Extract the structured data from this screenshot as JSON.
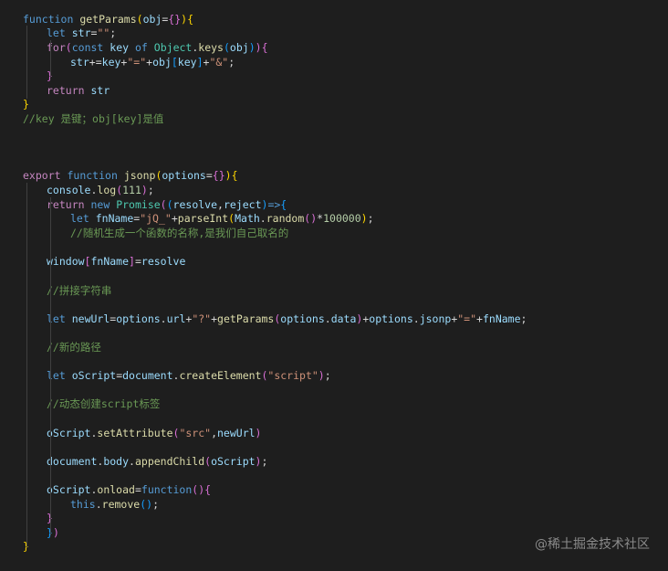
{
  "colors": {
    "background": "#1e1e1e",
    "keyword_control": "#c586c0",
    "keyword": "#569cd6",
    "function_name": "#dcdcaa",
    "variable": "#9cdcfe",
    "string": "#ce9178",
    "number": "#b5cea8",
    "comment": "#6a9955",
    "class_name": "#4ec9b0",
    "bracket_1": "#ffd700",
    "bracket_2": "#da70d6",
    "bracket_3": "#179fff",
    "plain": "#d4d4d4"
  },
  "code_lines": [
    {
      "tokens": [
        {
          "t": "function",
          "c": "keyword"
        },
        {
          "t": " ",
          "c": "plain"
        },
        {
          "t": "getParams",
          "c": "function_name"
        },
        {
          "t": "(",
          "c": "bracket_1"
        },
        {
          "t": "obj",
          "c": "variable"
        },
        {
          "t": "=",
          "c": "plain"
        },
        {
          "t": "{}",
          "c": "bracket_2"
        },
        {
          "t": ")",
          "c": "bracket_1"
        },
        {
          "t": "{",
          "c": "bracket_1"
        }
      ]
    },
    {
      "tokens": [
        {
          "t": "let",
          "c": "keyword"
        },
        {
          "t": " ",
          "c": "plain"
        },
        {
          "t": "str",
          "c": "variable"
        },
        {
          "t": "=",
          "c": "plain"
        },
        {
          "t": "\"\"",
          "c": "string"
        },
        {
          "t": ";",
          "c": "plain"
        }
      ]
    },
    {
      "tokens": [
        {
          "t": "for",
          "c": "keyword_control"
        },
        {
          "t": "(",
          "c": "bracket_2"
        },
        {
          "t": "const",
          "c": "keyword"
        },
        {
          "t": " ",
          "c": "plain"
        },
        {
          "t": "key",
          "c": "variable"
        },
        {
          "t": " ",
          "c": "plain"
        },
        {
          "t": "of",
          "c": "keyword"
        },
        {
          "t": " ",
          "c": "plain"
        },
        {
          "t": "Object",
          "c": "class_name"
        },
        {
          "t": ".",
          "c": "plain"
        },
        {
          "t": "keys",
          "c": "function_name"
        },
        {
          "t": "(",
          "c": "bracket_3"
        },
        {
          "t": "obj",
          "c": "variable"
        },
        {
          "t": ")",
          "c": "bracket_3"
        },
        {
          "t": ")",
          "c": "bracket_2"
        },
        {
          "t": "{",
          "c": "bracket_2"
        }
      ]
    },
    {
      "tokens": [
        {
          "t": "str",
          "c": "variable"
        },
        {
          "t": "+=",
          "c": "plain"
        },
        {
          "t": "key",
          "c": "variable"
        },
        {
          "t": "+",
          "c": "plain"
        },
        {
          "t": "\"=\"",
          "c": "string"
        },
        {
          "t": "+",
          "c": "plain"
        },
        {
          "t": "obj",
          "c": "variable"
        },
        {
          "t": "[",
          "c": "bracket_3"
        },
        {
          "t": "key",
          "c": "variable"
        },
        {
          "t": "]",
          "c": "bracket_3"
        },
        {
          "t": "+",
          "c": "plain"
        },
        {
          "t": "\"&\"",
          "c": "string"
        },
        {
          "t": ";",
          "c": "plain"
        }
      ]
    },
    {
      "tokens": [
        {
          "t": "}",
          "c": "bracket_2"
        }
      ]
    },
    {
      "tokens": [
        {
          "t": "return",
          "c": "keyword_control"
        },
        {
          "t": " ",
          "c": "plain"
        },
        {
          "t": "str",
          "c": "variable"
        }
      ]
    },
    {
      "tokens": [
        {
          "t": "}",
          "c": "bracket_1"
        }
      ]
    },
    {
      "tokens": [
        {
          "t": "//key 是键；obj[key]是值",
          "c": "comment"
        }
      ]
    },
    {
      "tokens": [
        {
          "t": "export",
          "c": "keyword_control"
        },
        {
          "t": " ",
          "c": "plain"
        },
        {
          "t": "function",
          "c": "keyword"
        },
        {
          "t": " ",
          "c": "plain"
        },
        {
          "t": "jsonp",
          "c": "function_name"
        },
        {
          "t": "(",
          "c": "bracket_1"
        },
        {
          "t": "options",
          "c": "variable"
        },
        {
          "t": "=",
          "c": "plain"
        },
        {
          "t": "{}",
          "c": "bracket_2"
        },
        {
          "t": ")",
          "c": "bracket_1"
        },
        {
          "t": "{",
          "c": "bracket_1"
        }
      ]
    },
    {
      "tokens": [
        {
          "t": "console",
          "c": "variable"
        },
        {
          "t": ".",
          "c": "plain"
        },
        {
          "t": "log",
          "c": "function_name"
        },
        {
          "t": "(",
          "c": "bracket_2"
        },
        {
          "t": "111",
          "c": "number"
        },
        {
          "t": ")",
          "c": "bracket_2"
        },
        {
          "t": ";",
          "c": "plain"
        }
      ]
    },
    {
      "tokens": [
        {
          "t": "return",
          "c": "keyword_control"
        },
        {
          "t": " ",
          "c": "plain"
        },
        {
          "t": "new",
          "c": "keyword"
        },
        {
          "t": " ",
          "c": "plain"
        },
        {
          "t": "Promise",
          "c": "class_name"
        },
        {
          "t": "(",
          "c": "bracket_2"
        },
        {
          "t": "(",
          "c": "bracket_3"
        },
        {
          "t": "resolve",
          "c": "variable"
        },
        {
          "t": ",",
          "c": "plain"
        },
        {
          "t": "reject",
          "c": "variable"
        },
        {
          "t": ")",
          "c": "bracket_3"
        },
        {
          "t": "=>",
          "c": "keyword"
        },
        {
          "t": "{",
          "c": "bracket_3"
        }
      ]
    },
    {
      "tokens": [
        {
          "t": "let",
          "c": "keyword"
        },
        {
          "t": " ",
          "c": "plain"
        },
        {
          "t": "fnName",
          "c": "variable"
        },
        {
          "t": "=",
          "c": "plain"
        },
        {
          "t": "\"jQ_\"",
          "c": "string"
        },
        {
          "t": "+",
          "c": "plain"
        },
        {
          "t": "parseInt",
          "c": "function_name"
        },
        {
          "t": "(",
          "c": "bracket_1"
        },
        {
          "t": "Math",
          "c": "variable"
        },
        {
          "t": ".",
          "c": "plain"
        },
        {
          "t": "random",
          "c": "function_name"
        },
        {
          "t": "(",
          "c": "bracket_2"
        },
        {
          "t": ")",
          "c": "bracket_2"
        },
        {
          "t": "*",
          "c": "plain"
        },
        {
          "t": "100000",
          "c": "number"
        },
        {
          "t": ")",
          "c": "bracket_1"
        },
        {
          "t": ";",
          "c": "plain"
        }
      ]
    },
    {
      "tokens": [
        {
          "t": "//随机生成一个函数的名称,是我们自己取名的",
          "c": "comment"
        }
      ]
    },
    {
      "tokens": [
        {
          "t": "window",
          "c": "variable"
        },
        {
          "t": "[",
          "c": "bracket_2"
        },
        {
          "t": "fnName",
          "c": "variable"
        },
        {
          "t": "]",
          "c": "bracket_2"
        },
        {
          "t": "=",
          "c": "plain"
        },
        {
          "t": "resolve",
          "c": "variable"
        }
      ]
    },
    {
      "tokens": [
        {
          "t": "//拼接字符串",
          "c": "comment"
        }
      ]
    },
    {
      "tokens": [
        {
          "t": "let",
          "c": "keyword"
        },
        {
          "t": " ",
          "c": "plain"
        },
        {
          "t": "newUrl",
          "c": "variable"
        },
        {
          "t": "=",
          "c": "plain"
        },
        {
          "t": "options",
          "c": "variable"
        },
        {
          "t": ".",
          "c": "plain"
        },
        {
          "t": "url",
          "c": "variable"
        },
        {
          "t": "+",
          "c": "plain"
        },
        {
          "t": "\"?\"",
          "c": "string"
        },
        {
          "t": "+",
          "c": "plain"
        },
        {
          "t": "getParams",
          "c": "function_name"
        },
        {
          "t": "(",
          "c": "bracket_2"
        },
        {
          "t": "options",
          "c": "variable"
        },
        {
          "t": ".",
          "c": "plain"
        },
        {
          "t": "data",
          "c": "variable"
        },
        {
          "t": ")",
          "c": "bracket_2"
        },
        {
          "t": "+",
          "c": "plain"
        },
        {
          "t": "options",
          "c": "variable"
        },
        {
          "t": ".",
          "c": "plain"
        },
        {
          "t": "jsonp",
          "c": "variable"
        },
        {
          "t": "+",
          "c": "plain"
        },
        {
          "t": "\"=\"",
          "c": "string"
        },
        {
          "t": "+",
          "c": "plain"
        },
        {
          "t": "fnName",
          "c": "variable"
        },
        {
          "t": ";",
          "c": "plain"
        }
      ]
    },
    {
      "tokens": [
        {
          "t": "//新的路径",
          "c": "comment"
        }
      ]
    },
    {
      "tokens": [
        {
          "t": "let",
          "c": "keyword"
        },
        {
          "t": " ",
          "c": "plain"
        },
        {
          "t": "oScript",
          "c": "variable"
        },
        {
          "t": "=",
          "c": "plain"
        },
        {
          "t": "document",
          "c": "variable"
        },
        {
          "t": ".",
          "c": "plain"
        },
        {
          "t": "createElement",
          "c": "function_name"
        },
        {
          "t": "(",
          "c": "bracket_2"
        },
        {
          "t": "\"script\"",
          "c": "string"
        },
        {
          "t": ")",
          "c": "bracket_2"
        },
        {
          "t": ";",
          "c": "plain"
        }
      ]
    },
    {
      "tokens": [
        {
          "t": "//动态创建script标签",
          "c": "comment"
        }
      ]
    },
    {
      "tokens": [
        {
          "t": "oScript",
          "c": "variable"
        },
        {
          "t": ".",
          "c": "plain"
        },
        {
          "t": "setAttribute",
          "c": "function_name"
        },
        {
          "t": "(",
          "c": "bracket_2"
        },
        {
          "t": "\"src\"",
          "c": "string"
        },
        {
          "t": ",",
          "c": "plain"
        },
        {
          "t": "newUrl",
          "c": "variable"
        },
        {
          "t": ")",
          "c": "bracket_2"
        }
      ]
    },
    {
      "tokens": [
        {
          "t": "document",
          "c": "variable"
        },
        {
          "t": ".",
          "c": "plain"
        },
        {
          "t": "body",
          "c": "variable"
        },
        {
          "t": ".",
          "c": "plain"
        },
        {
          "t": "appendChild",
          "c": "function_name"
        },
        {
          "t": "(",
          "c": "bracket_2"
        },
        {
          "t": "oScript",
          "c": "variable"
        },
        {
          "t": ")",
          "c": "bracket_2"
        },
        {
          "t": ";",
          "c": "plain"
        }
      ]
    },
    {
      "tokens": [
        {
          "t": "oScript",
          "c": "variable"
        },
        {
          "t": ".",
          "c": "plain"
        },
        {
          "t": "onload",
          "c": "function_name"
        },
        {
          "t": "=",
          "c": "plain"
        },
        {
          "t": "function",
          "c": "keyword"
        },
        {
          "t": "(",
          "c": "bracket_2"
        },
        {
          "t": ")",
          "c": "bracket_2"
        },
        {
          "t": "{",
          "c": "bracket_2"
        }
      ]
    },
    {
      "tokens": [
        {
          "t": "this",
          "c": "keyword"
        },
        {
          "t": ".",
          "c": "plain"
        },
        {
          "t": "remove",
          "c": "function_name"
        },
        {
          "t": "(",
          "c": "bracket_3"
        },
        {
          "t": ")",
          "c": "bracket_3"
        },
        {
          "t": ";",
          "c": "plain"
        }
      ]
    },
    {
      "tokens": [
        {
          "t": "}",
          "c": "bracket_2"
        }
      ]
    },
    {
      "tokens": [
        {
          "t": "}",
          "c": "bracket_3"
        },
        {
          "t": ")",
          "c": "bracket_2"
        }
      ]
    },
    {
      "tokens": [
        {
          "t": "}",
          "c": "bracket_1"
        }
      ]
    }
  ],
  "watermark": "@稀土掘金技术社区"
}
